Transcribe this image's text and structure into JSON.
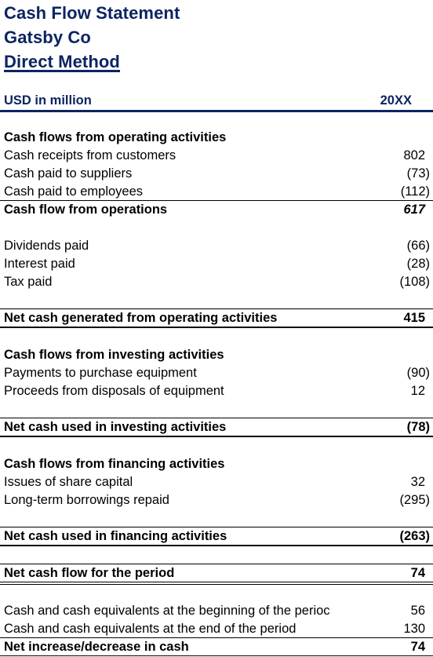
{
  "header": {
    "title": "Cash Flow Statement",
    "company": "Gatsby Co",
    "method": "Direct Method",
    "currency_label": "USD in million",
    "period_label": "20XX",
    "accent_color": "#0c2461"
  },
  "operating": {
    "heading": "Cash flows from operating activities",
    "items": [
      {
        "label": "Cash receipts from customers",
        "value": "802"
      },
      {
        "label": "Cash paid to suppliers",
        "value": "(73)"
      },
      {
        "label": "Cash paid to employees",
        "value": "(112)"
      }
    ],
    "subtotal": {
      "label": "Cash flow from operations",
      "value": "617"
    },
    "other_items": [
      {
        "label": "Dividends paid",
        "value": "(66)"
      },
      {
        "label": "Interest paid",
        "value": "(28)"
      },
      {
        "label": "Tax paid",
        "value": "(108)"
      }
    ],
    "total": {
      "label": "Net cash generated from operating activities",
      "value": "415"
    }
  },
  "investing": {
    "heading": "Cash flows from investing activities",
    "items": [
      {
        "label": "Payments to purchase equipment",
        "value": "(90)"
      },
      {
        "label": "Proceeds from disposals of equipment",
        "value": "12"
      }
    ],
    "total": {
      "label": "Net cash used in investing activities",
      "value": "(78)"
    }
  },
  "financing": {
    "heading": "Cash flows from financing activities",
    "items": [
      {
        "label": "Issues of share capital",
        "value": "32"
      },
      {
        "label": "Long-term borrowings repaid",
        "value": "(295)"
      }
    ],
    "total": {
      "label": "Net cash used in financing activities",
      "value": "(263)"
    }
  },
  "net_flow": {
    "label": "Net cash flow for the period",
    "value": "74"
  },
  "reconciliation": {
    "items": [
      {
        "label": "Cash and cash equivalents at the beginning of the perioc",
        "value": "56"
      },
      {
        "label": "Cash and cash equivalents at the end of the period",
        "value": "130"
      }
    ],
    "total": {
      "label": "Net increase/decrease in cash",
      "value": "74"
    }
  }
}
